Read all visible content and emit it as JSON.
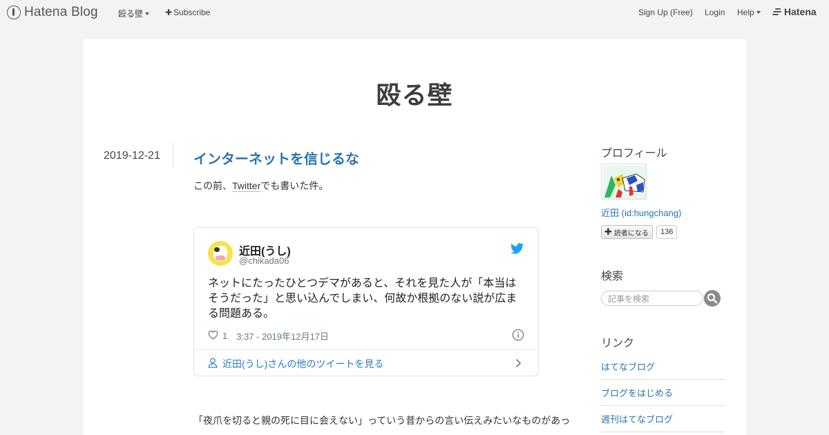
{
  "global_header": {
    "logo_text": "Hatena Blog",
    "blog_name": "殴る壁",
    "subscribe_label": "Subscribe",
    "signup_label": "Sign Up (Free)",
    "login_label": "Login",
    "help_label": "Help",
    "hatena_label": "Hatena"
  },
  "blog": {
    "title": "殴る壁"
  },
  "entry": {
    "date": "2019-12-21",
    "title": "インターネットを信じるな",
    "intro_before": "この前、",
    "intro_link": "Twitter",
    "intro_after": "でも書いた件。",
    "body_line1": "「夜爪を切ると親の死に目に会えない」っていう昔からの言い伝えみたいなものがあっ"
  },
  "tweet": {
    "name": "近田(うし)",
    "handle": "@chikada06",
    "text": "ネットにたったひとつデマがあると、それを見た人が「本当はそうだった」と思い込んでしまい、何故か根拠のない説が広まる問題ある。",
    "likes": "1",
    "time": "3:37 - 2019年12月17日",
    "footer_link": "近田(うし)さんの他のツイートを見る"
  },
  "sidebar": {
    "profile_heading": "プロフィール",
    "profile_name": "近田 (id:hungchang)",
    "follow_label": "読者になる",
    "reader_count": "136",
    "search_heading": "検索",
    "search_placeholder": "記事を検索",
    "links_heading": "リンク",
    "links": [
      {
        "label": "はてなブログ"
      },
      {
        "label": "ブログをはじめる"
      },
      {
        "label": "週刊はてなブログ"
      }
    ]
  },
  "colors": {
    "link": "#2a72b0",
    "twitter": "#1da1f2",
    "page_bg": "#f3f3f3"
  }
}
